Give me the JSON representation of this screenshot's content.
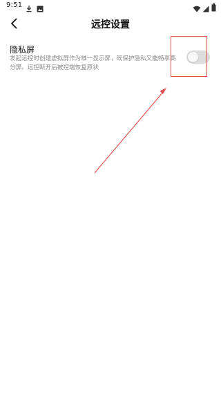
{
  "status_bar": {
    "time": "9:51",
    "left_icons": [
      "download-icon",
      "photo-icon"
    ],
    "right_icons": [
      "wifi-icon",
      "signal-icon",
      "battery-icon"
    ]
  },
  "header": {
    "title": "远控设置",
    "back_icon": "back-arrow-icon"
  },
  "setting": {
    "title": "隐私屏",
    "description": "发起远控时创建虚拟屏作为唯一显示屏，既保护隐私又能畅享高分屏。远控断开后被控端恢复原状",
    "toggle_on": false
  },
  "annotation": {
    "color": "#e04d4d"
  }
}
